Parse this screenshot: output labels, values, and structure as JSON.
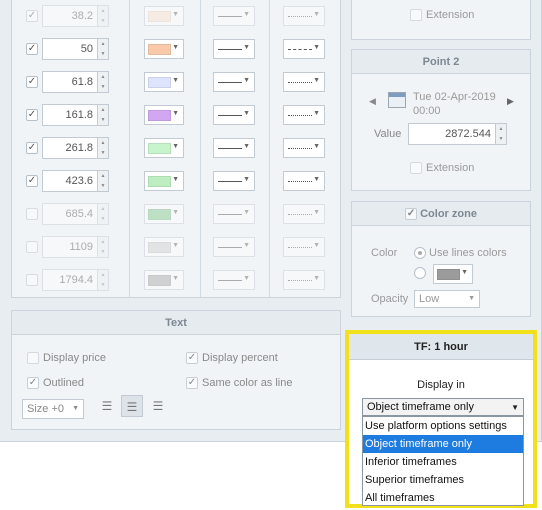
{
  "levels": [
    {
      "checked": true,
      "value": "38.2",
      "color": "#fde3cf",
      "style": "solid",
      "style2": "dot",
      "disabled": true
    },
    {
      "checked": true,
      "value": "50",
      "color": "#f9c9a9",
      "style": "solid",
      "style2": "dash",
      "disabled": false
    },
    {
      "checked": true,
      "value": "61.8",
      "color": "#dde4fb",
      "style": "solid",
      "style2": "dot",
      "disabled": false
    },
    {
      "checked": true,
      "value": "161.8",
      "color": "#d2a6f0",
      "style": "solid",
      "style2": "dot",
      "disabled": false
    },
    {
      "checked": true,
      "value": "261.8",
      "color": "#c8f4cc",
      "style": "solid",
      "style2": "dot",
      "disabled": false
    },
    {
      "checked": true,
      "value": "423.6",
      "color": "#bdeec0",
      "style": "solid",
      "style2": "dot",
      "disabled": false
    },
    {
      "checked": false,
      "value": "685.4",
      "color": "#7fc98a",
      "style": "solid",
      "style2": "dot",
      "disabled": true
    },
    {
      "checked": false,
      "value": "1109",
      "color": "#cfcfcf",
      "style": "solid",
      "style2": "dot",
      "disabled": true
    },
    {
      "checked": false,
      "value": "1794.4",
      "color": "#a6a6a6",
      "style": "solid",
      "style2": "dot",
      "disabled": true
    }
  ],
  "text": {
    "title": "Text",
    "display_price": "Display price",
    "display_percent": "Display percent",
    "outlined": "Outlined",
    "same_color": "Same color as line",
    "size": "Size +0"
  },
  "extension_top": "Extension",
  "point2": {
    "title": "Point 2",
    "date": "Tue 02-Apr-2019",
    "time": "00:00",
    "value_label": "Value",
    "value": "2872.544",
    "extension": "Extension"
  },
  "color_zone": {
    "title": "Color zone",
    "color_label": "Color",
    "use_lines_colors": "Use lines colors",
    "opacity_label": "Opacity",
    "opacity_value": "Low"
  },
  "tf": {
    "title": "TF: 1 hour",
    "display_in": "Display in",
    "selected": "Object timeframe only",
    "options": [
      "Use platform options settings",
      "Object timeframe only",
      "Inferior timeframes",
      "Superior timeframes",
      "All timeframes"
    ],
    "selected_index": 1
  },
  "colors": {
    "highlight": "#f2e01a",
    "selection": "#1e7be0"
  }
}
